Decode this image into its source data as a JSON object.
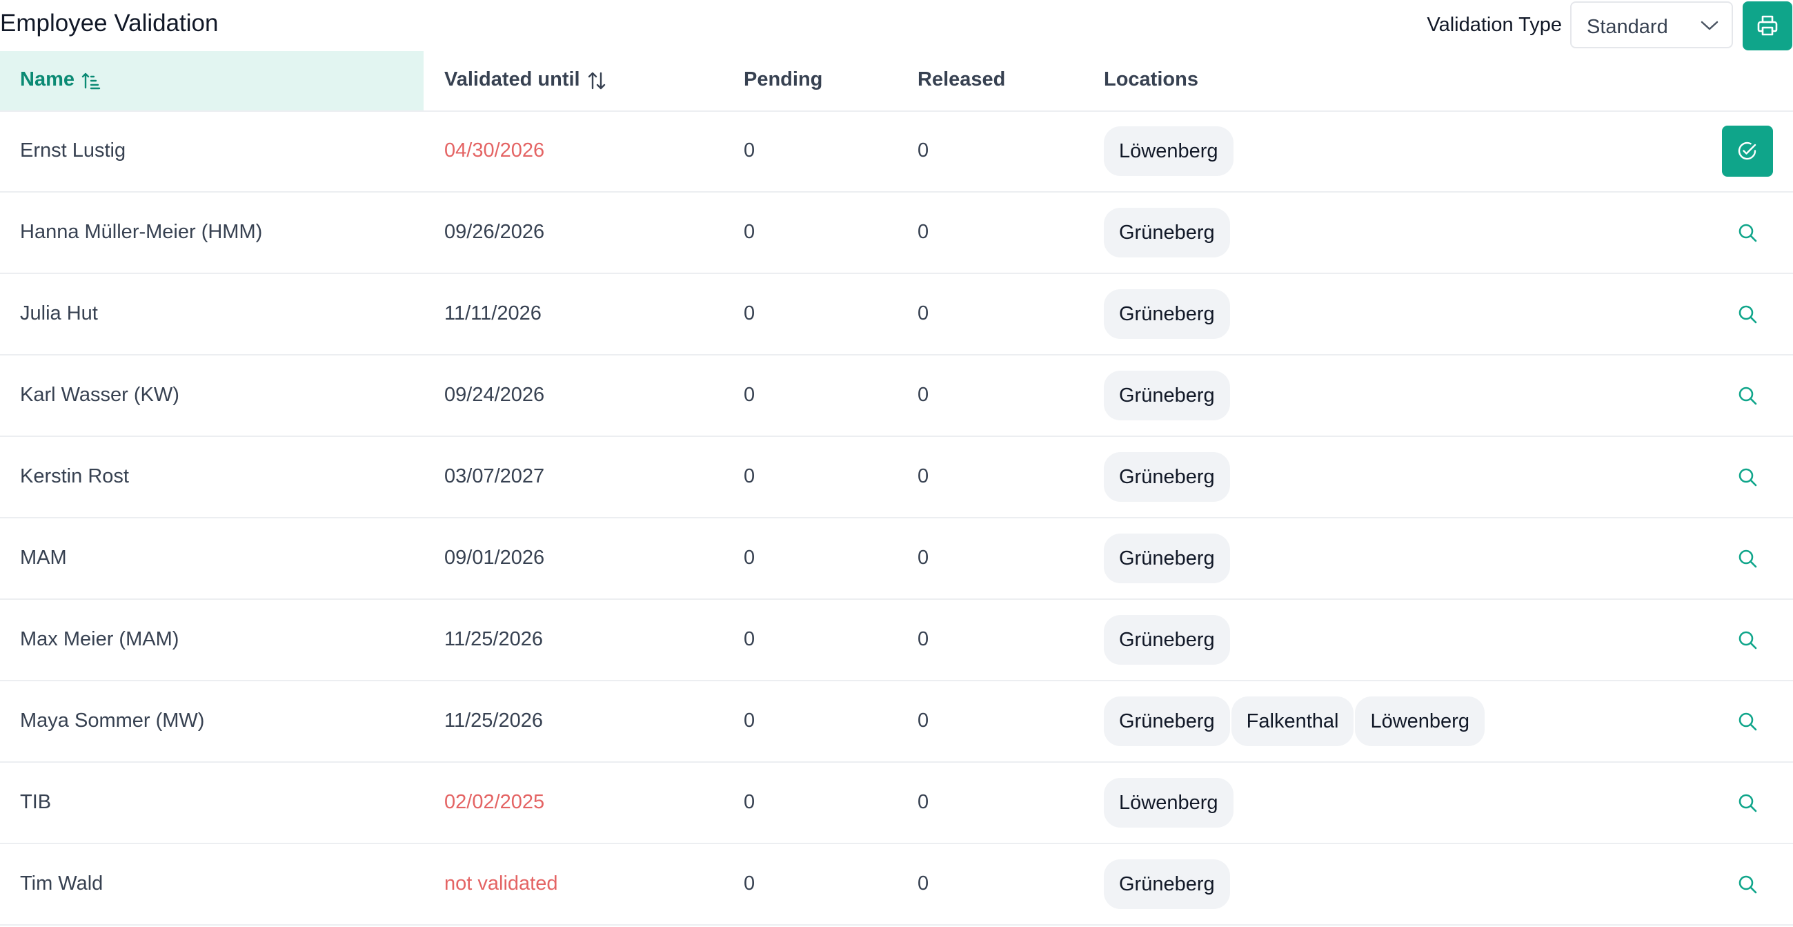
{
  "header": {
    "title": "Employee Validation",
    "validation_type_label": "Validation Type",
    "validation_type_value": "Standard"
  },
  "table": {
    "columns": {
      "name": "Name",
      "validated_until": "Validated until",
      "pending": "Pending",
      "released": "Released",
      "locations": "Locations"
    },
    "rows": [
      {
        "name": "Ernst Lustig",
        "validated_until": "04/30/2026",
        "pending": "0",
        "released": "0",
        "locations": [
          "Löwenberg"
        ],
        "action": "check-circle-icon"
      },
      {
        "name": "Hanna Müller-Meier (HMM)",
        "validated_until": "09/26/2026",
        "pending": "0",
        "released": "0",
        "locations": [
          "Grüneberg"
        ],
        "action": "search-icon"
      },
      {
        "name": "Julia Hut",
        "validated_until": "11/11/2026",
        "pending": "0",
        "released": "0",
        "locations": [
          "Grüneberg"
        ],
        "action": "search-icon"
      },
      {
        "name": "Karl Wasser (KW)",
        "validated_until": "09/24/2026",
        "pending": "0",
        "released": "0",
        "locations": [
          "Grüneberg"
        ],
        "action": "search-icon"
      },
      {
        "name": "Kerstin Rost",
        "validated_until": "03/07/2027",
        "pending": "0",
        "released": "0",
        "locations": [
          "Grüneberg"
        ],
        "action": "search-icon"
      },
      {
        "name": "MAM",
        "validated_until": "09/01/2026",
        "pending": "0",
        "released": "0",
        "locations": [
          "Grüneberg"
        ],
        "action": "search-icon"
      },
      {
        "name": "Max Meier (MAM)",
        "validated_until": "11/25/2026",
        "pending": "0",
        "released": "0",
        "locations": [
          "Grüneberg"
        ],
        "action": "search-icon"
      },
      {
        "name": "Maya Sommer (MW)",
        "validated_until": "11/25/2026",
        "pending": "0",
        "released": "0",
        "locations": [
          "Grüneberg",
          "Falkenthal",
          "Löwenberg"
        ],
        "action": "search-icon"
      },
      {
        "name": "TIB",
        "validated_until": "02/02/2025",
        "pending": "0",
        "released": "0",
        "locations": [
          "Löwenberg"
        ],
        "action": "search-icon"
      },
      {
        "name": "Tim Wald",
        "validated_until": "not validated",
        "pending": "0",
        "released": "0",
        "locations": [
          "Grüneberg"
        ],
        "action": "search-icon"
      }
    ]
  },
  "colors": {
    "accent": "#0fa58a",
    "header_highlight_bg": "#e2f5f1",
    "warning_text": "#e46464",
    "chip_bg": "#f1f3f6"
  }
}
